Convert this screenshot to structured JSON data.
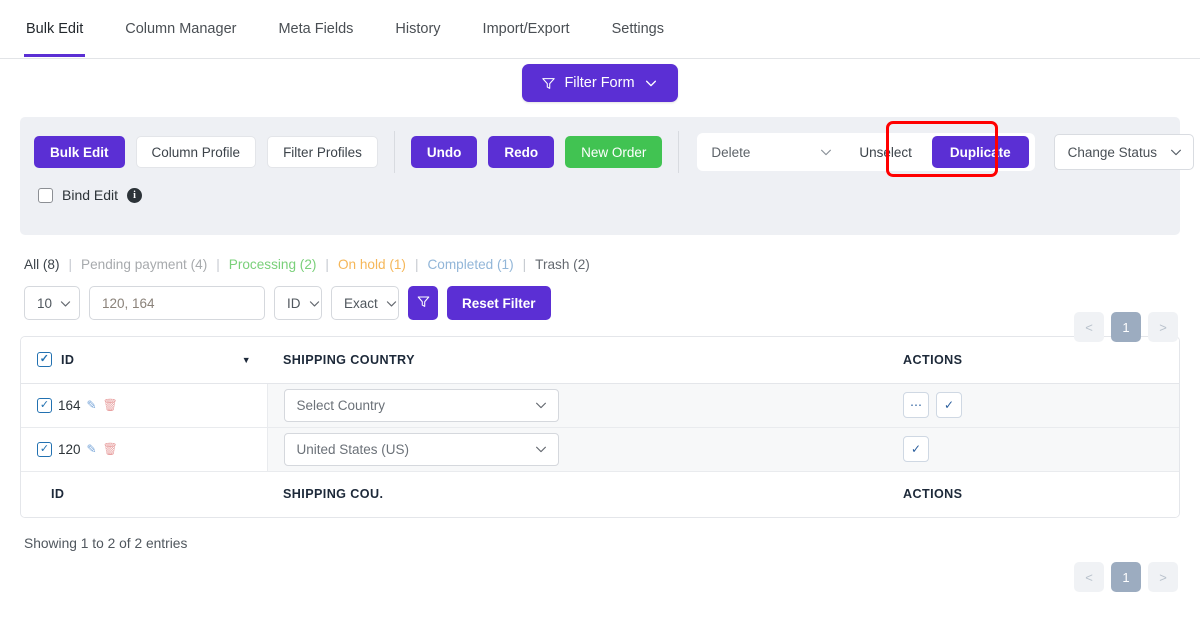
{
  "tabs": [
    {
      "label": "Bulk Edit",
      "active": true
    },
    {
      "label": "Column Manager",
      "active": false
    },
    {
      "label": "Meta Fields",
      "active": false
    },
    {
      "label": "History",
      "active": false
    },
    {
      "label": "Import/Export",
      "active": false
    },
    {
      "label": "Settings",
      "active": false
    }
  ],
  "filter_form": {
    "label": "Filter Form",
    "icon": "funnel-icon",
    "chevron": "chevron-down-icon"
  },
  "toolbar": {
    "bulk_edit": "Bulk Edit",
    "column_profile": "Column Profile",
    "filter_profiles": "Filter Profiles",
    "undo": "Undo",
    "redo": "Redo",
    "new_order": "New Order",
    "delete_select": "Delete",
    "unselect": "Unselect",
    "duplicate": "Duplicate",
    "change_status": "Change Status",
    "bind_edit": "Bind Edit",
    "info_glyph": "i",
    "highlight_color": "#ff0000",
    "highlighted_element": "duplicate"
  },
  "status_links": [
    {
      "label": "All (8)",
      "color": "#3c434a"
    },
    {
      "label": "Pending payment (4)",
      "color": "#a7aaad"
    },
    {
      "label": "Processing (2)",
      "color": "#7ad07a"
    },
    {
      "label": "On hold (1)",
      "color": "#f5b759"
    },
    {
      "label": "Completed (1)",
      "color": "#92b6d8"
    },
    {
      "label": "Trash (2)",
      "color": "#646970"
    }
  ],
  "filter_row": {
    "per_page": "10",
    "search_value": "120, 164",
    "field": "ID",
    "match": "Exact",
    "funnel_icon": "funnel-icon",
    "reset": "Reset Filter"
  },
  "pagination": {
    "prev": "<",
    "current": "1",
    "next": ">"
  },
  "table": {
    "header": {
      "id": "ID",
      "shipping_country": "SHIPPING COUNTRY",
      "actions": "ACTIONS"
    },
    "footer": {
      "id": "ID",
      "shipping_country": "SHIPPING COU.",
      "actions": "ACTIONS"
    },
    "rows": [
      {
        "id": "164",
        "checked": true,
        "country": "Select Country",
        "actions": [
          "ellipsis-icon",
          "check-icon"
        ]
      },
      {
        "id": "120",
        "checked": true,
        "country": "United States (US)",
        "actions": [
          "check-icon"
        ]
      }
    ]
  },
  "footer": {
    "showing": "Showing 1 to 2 of 2 entries"
  }
}
